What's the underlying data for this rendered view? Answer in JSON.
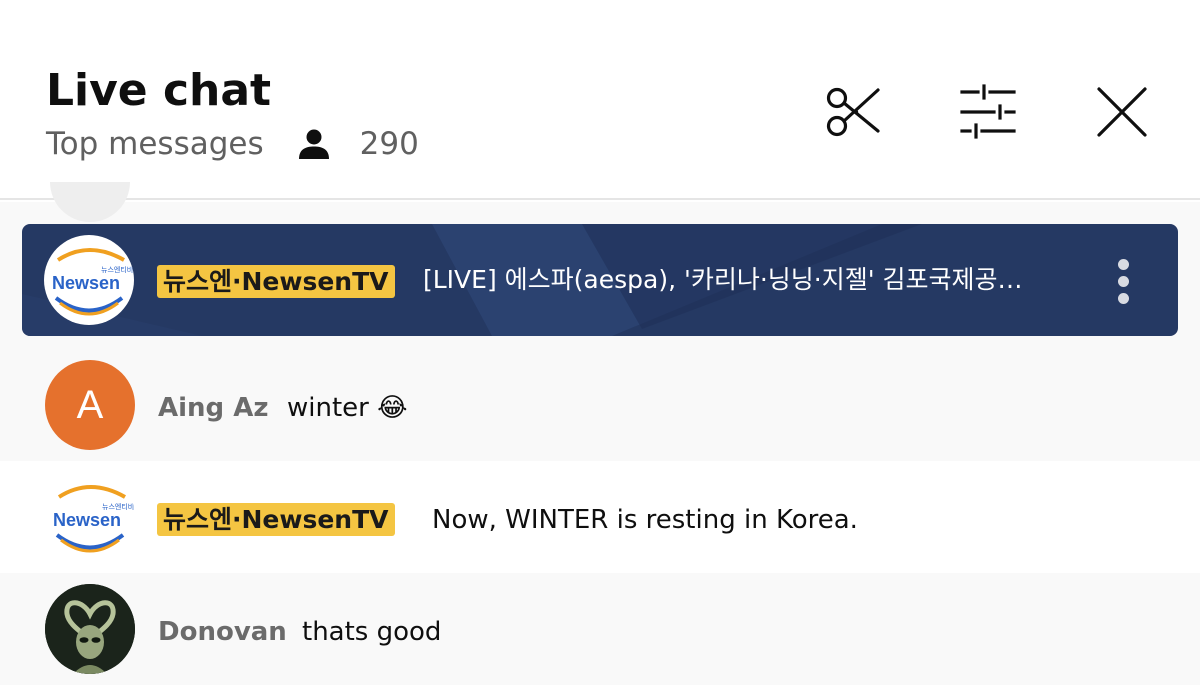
{
  "header": {
    "title": "Live chat",
    "mode_label": "Top messages",
    "viewer_count": "290",
    "actions": [
      "scissors-icon",
      "sliders-icon",
      "close-icon"
    ]
  },
  "pinned": {
    "author": "뉴스엔·NewsenTV",
    "text": "[LIVE] 에스파(aespa), '카리나·닝닝·지젤' 김포국제공…",
    "logo_text": "Newsen",
    "logo_small_text": "뉴스엔티비",
    "background_color": "#253963"
  },
  "messages": [
    {
      "author": "Aing Az",
      "text": "winter 😂",
      "avatar_initial": "A",
      "avatar_color": "#e5712d",
      "row_background": "#f9f9f9"
    },
    {
      "author": "뉴스엔·NewsenTV",
      "text": "Now, WINTER is resting in Korea.",
      "logo_text": "Newsen",
      "logo_small_text": "뉴스엔티비",
      "row_background": "#ffffff"
    },
    {
      "author": "Donovan",
      "text": "thats good",
      "avatar_icon": "alien-heart-avatar",
      "row_background": "#f9f9f9"
    }
  ],
  "colors": {
    "owner_chip": "#f4c542",
    "author_text": "#6b6b6b",
    "message_text": "#0f0f0f"
  }
}
